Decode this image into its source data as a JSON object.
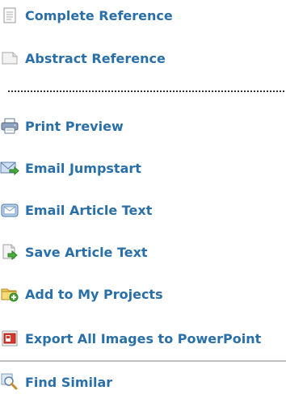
{
  "menu": {
    "items": [
      {
        "label": "Complete Reference",
        "icon": "document-icon"
      },
      {
        "label": "Abstract Reference",
        "icon": "document-corner-icon"
      },
      {
        "label": "Print Preview",
        "icon": "printer-icon"
      },
      {
        "label": "Email Jumpstart",
        "icon": "email-jumpstart-icon"
      },
      {
        "label": "Email Article Text",
        "icon": "email-icon"
      },
      {
        "label": "Save Article Text",
        "icon": "save-icon"
      },
      {
        "label": "Add to My Projects",
        "icon": "folder-add-icon"
      },
      {
        "label": "Export All Images to PowerPoint",
        "icon": "powerpoint-icon"
      },
      {
        "label": "Find Similar",
        "icon": "magnifier-icon"
      }
    ]
  },
  "colors": {
    "link": "#2a6fa8",
    "dotted_rule": "#333333",
    "solid_rule": "#bfbfbf"
  }
}
